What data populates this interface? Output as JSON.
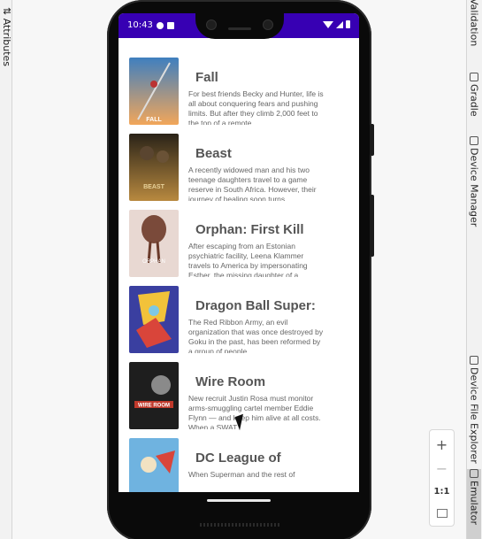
{
  "ide": {
    "left_tab": "Attributes",
    "left_tab_icon": "sliders-icon",
    "right_tabs": [
      {
        "label": "Validation",
        "icon": "layout-validation-icon"
      },
      {
        "label": "Gradle",
        "icon": "gradle-elephant-icon"
      },
      {
        "label": "Device Manager",
        "icon": "device-manager-icon"
      },
      {
        "label": "Device File Explorer",
        "icon": "file-explorer-icon"
      },
      {
        "label": "Emulator",
        "icon": "emulator-icon"
      }
    ],
    "zoom": {
      "zoom_in": "+",
      "zoom_out": "−",
      "actual_size": "1:1"
    }
  },
  "phone": {
    "status_bar": {
      "time": "10:43",
      "background": "#3700b3"
    }
  },
  "movies": [
    {
      "title": "Fall",
      "description": "For best friends Becky and Hunter, life is all about conquering fears and pushing limits. But after they climb 2,000 feet to the top of a remote,",
      "poster_text": "FALL",
      "colors": [
        "#3f7fbf",
        "#f2a65a"
      ]
    },
    {
      "title": "Beast",
      "description": "A recently widowed man and his two teenage daughters travel to a game reserve in South Africa. However, their journey of healing soon turns",
      "poster_text": "BEAST",
      "colors": [
        "#2a2318",
        "#b8893f"
      ]
    },
    {
      "title": "Orphan: First Kill",
      "description": "After escaping from an Estonian psychiatric facility, Leena Klammer travels to America by impersonating Esther, the missing daughter of a",
      "poster_text": "ORPHAN",
      "colors": [
        "#e8d8d2",
        "#7a4a3a"
      ]
    },
    {
      "title": "Dragon Ball Super:",
      "description": "The Red Ribbon Army, an evil organization that was once destroyed by Goku in the past, has been reformed by a group of people",
      "poster_text": "",
      "colors": [
        "#3a3fa0",
        "#f2c23a"
      ]
    },
    {
      "title": "Wire Room",
      "description": "New recruit Justin Rosa must monitor arms-smuggling cartel member Eddie Flynn — and keep him alive at all costs. When a SWAT",
      "poster_text": "WIRE ROOM",
      "colors": [
        "#1e1e1e",
        "#c0392b"
      ]
    },
    {
      "title": "DC League of",
      "description": "When Superman and the rest of",
      "poster_text": "",
      "colors": [
        "#6fb3e0",
        "#d9453a"
      ]
    }
  ]
}
